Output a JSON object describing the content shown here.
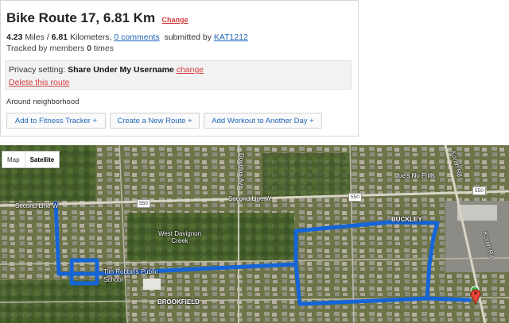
{
  "route": {
    "title": "Bike Route 17, 6.81 Km",
    "change_label": "Change",
    "miles_value": "4.23",
    "miles_unit": " Miles / ",
    "km_value": "6.81",
    "km_unit": " Kilometers, ",
    "comments_link": "0 comments",
    "submitted_by_label": "submitted by ",
    "author": "KAT1212",
    "tracked_prefix": "Tracked by members ",
    "tracked_count": "0",
    "tracked_suffix": " times"
  },
  "privacy": {
    "label": "Privacy setting: ",
    "value": "Share Under My Username",
    "change_label": "change",
    "delete_label": "Delete this route"
  },
  "neighborhood": "Around neighborhood",
  "buttons": {
    "fitness": "Add to Fitness Tracker +",
    "new_route": "Create a New Route +",
    "workout": "Add Workout to Another Day +"
  },
  "map": {
    "map_label": "Map",
    "satellite_label": "Satellite",
    "labels": {
      "second_line_w_left": "Second Line W",
      "second_line_w_mid": "Second Line W",
      "douglas_ave": "Douglas Ave",
      "west_davignon_creek": "West Davignon Creek",
      "tim_robbins": "Tim Robbins Public School",
      "brookfield": "BROOKFIELD",
      "joes_no_frills": "Joe's No Frills",
      "korah_rd_top": "Korah Rd",
      "korah_rd_bottom": "Korah Rd",
      "buckley": "BUCKLEY"
    },
    "shields": {
      "s1": "550",
      "s2": "550",
      "s3": "550"
    },
    "colors": {
      "route": "#1565d8",
      "marker_end": "#e8473a",
      "marker_start": "#3cb043"
    }
  }
}
